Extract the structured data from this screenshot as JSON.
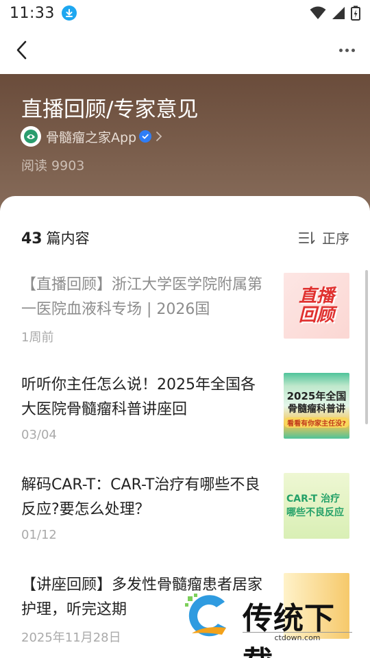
{
  "status": {
    "time": "11:33"
  },
  "header": {
    "title": "直播回顾/专家意见",
    "author": "骨髓瘤之家App",
    "read_label": "阅读 9903"
  },
  "list": {
    "count": "43",
    "count_label": "篇内容",
    "sort_label": "正序",
    "items": [
      {
        "title": "【直播回顾】浙江大学医学院附属第一医院血液科专场 | 2026国",
        "date": "1周前",
        "thumb_text": [
          "直播",
          "回顾"
        ]
      },
      {
        "title": "听听你主任怎么说！2025年全国各大医院骨髓瘤科普讲座回",
        "date": "03/04",
        "thumb_text": [
          "2025年全国",
          "骨髓瘤科普讲",
          "看看有你家主任没?"
        ]
      },
      {
        "title": "解码CAR-T：CAR-T治疗有哪些不良反应?要怎么处理？",
        "date": "01/12",
        "thumb_text": [
          "CAR-T 治疗",
          "哪些不良反应"
        ]
      },
      {
        "title": "【讲座回顾】多发性骨髓瘤患者居家护理，听完这期",
        "date": "2025年11月28日"
      }
    ]
  },
  "watermark": {
    "text": "传统下载",
    "url": "ctdown.com"
  },
  "colors": {
    "hero": "#6a4c3b",
    "accent": "#1ea7f0",
    "verified": "#2f7df6"
  }
}
